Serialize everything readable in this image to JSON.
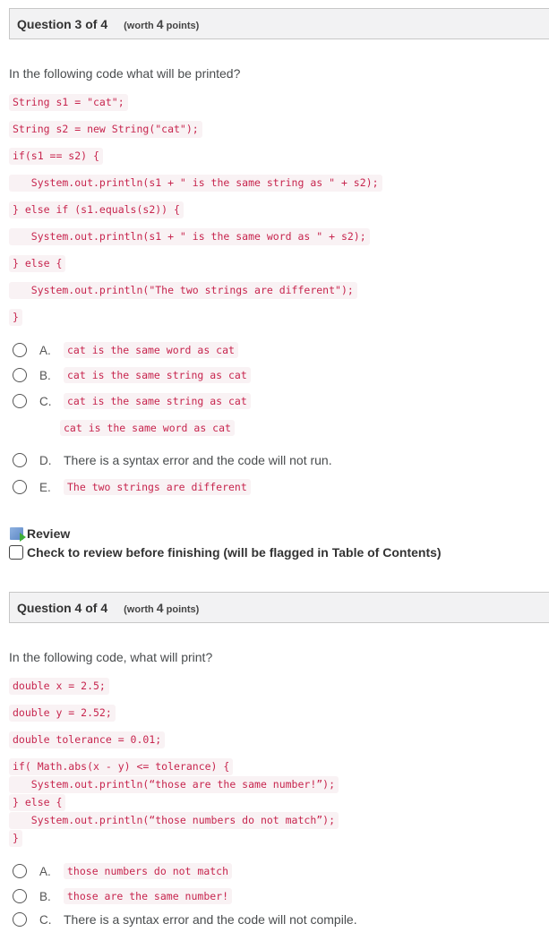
{
  "questions": [
    {
      "title": "Question 3 of 4",
      "worth_prefix": "(worth ",
      "worth_points": "4",
      "worth_suffix": " points)",
      "prompt": "In the following code what will be printed?",
      "code_lines": [
        "String s1 = \"cat\";",
        "String s2 = new String(\"cat\");",
        "if(s1 == s2) {",
        "   System.out.println(s1 + \" is the same string as \" + s2);",
        "} else if (s1.equals(s2)) {",
        "   System.out.println(s1 + \" is the same word as \" + s2);",
        "} else {",
        "   System.out.println(\"The two strings are different\");",
        "}"
      ],
      "options": [
        {
          "letter": "A.",
          "code": "cat is the same word as cat"
        },
        {
          "letter": "B.",
          "code": "cat is the same string as cat"
        },
        {
          "letter": "C.",
          "code": "cat is the same string as cat",
          "code2": "cat is the same word as cat"
        },
        {
          "letter": "D.",
          "text": "There is a syntax error and the code will not run."
        },
        {
          "letter": "E.",
          "code": "The two strings are different"
        }
      ],
      "review_label": "Review",
      "flag_label": "Check to review before finishing (will be flagged in Table of Contents)"
    },
    {
      "title": "Question 4 of 4",
      "worth_prefix": "(worth ",
      "worth_points": "4",
      "worth_suffix": " points)",
      "prompt": "In the following code, what will print?",
      "code_lines": [
        "double x = 2.5;",
        "double y = 2.52;",
        "double tolerance = 0.01;",
        "if( Math.abs(x - y) <= tolerance) {",
        "   System.out.println(“those are the same number!”);",
        "} else {",
        "   System.out.println(“those numbers do not match”);",
        "}"
      ],
      "options": [
        {
          "letter": "A.",
          "code": "those numbers do not match"
        },
        {
          "letter": "B.",
          "code": "those are the same number!"
        },
        {
          "letter": "C.",
          "text": "There is a syntax error and the code will not compile."
        }
      ]
    }
  ]
}
